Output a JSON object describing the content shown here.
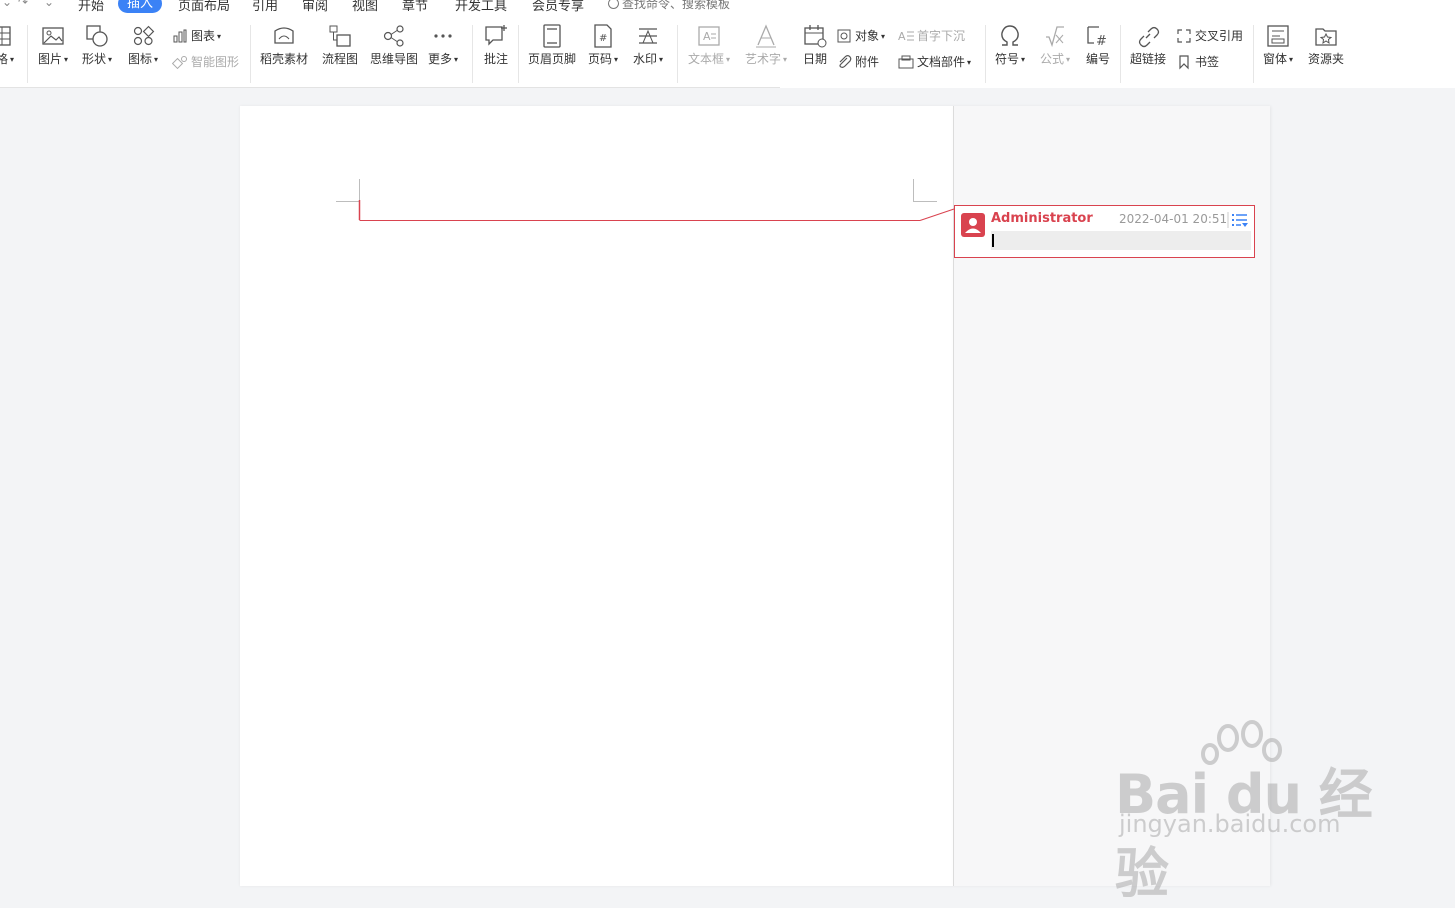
{
  "menu": {
    "tabs": [
      {
        "label": "开始"
      },
      {
        "label": "插入",
        "active": true
      },
      {
        "label": "页面布局"
      },
      {
        "label": "引用"
      },
      {
        "label": "审阅"
      },
      {
        "label": "视图"
      },
      {
        "label": "章节"
      },
      {
        "label": "开发工具"
      },
      {
        "label": "会员专享"
      }
    ],
    "search_placeholder": "查找命令、搜索模板"
  },
  "ribbon": {
    "table_partial": "格",
    "picture": "图片",
    "shape": "形状",
    "icon": "图标",
    "chart": "图表",
    "smart_graphic": "智能图形",
    "daoke": "稻壳素材",
    "flowchart": "流程图",
    "mindmap": "思维导图",
    "more": "更多",
    "comment": "批注",
    "header_footer": "页眉页脚",
    "page_number": "页码",
    "watermark": "水印",
    "textbox": "文本框",
    "wordart": "艺术字",
    "date": "日期",
    "object": "对象",
    "drop_cap": "首字下沉",
    "attachment": "附件",
    "doc_part": "文档部件",
    "symbol": "符号",
    "formula": "公式",
    "numbering": "编号",
    "hyperlink": "超链接",
    "cross_ref": "交叉引用",
    "bookmark": "书签",
    "window": "窗体",
    "resources": "资源夹"
  },
  "comment": {
    "author": "Administrator",
    "timestamp": "2022-04-01 20:51",
    "text": ""
  },
  "watermark": {
    "brand": "Bai du 经验",
    "url": "jingyan.baidu.com"
  },
  "colors": {
    "accent": "#3b82f6",
    "comment_red": "#d9434f"
  }
}
